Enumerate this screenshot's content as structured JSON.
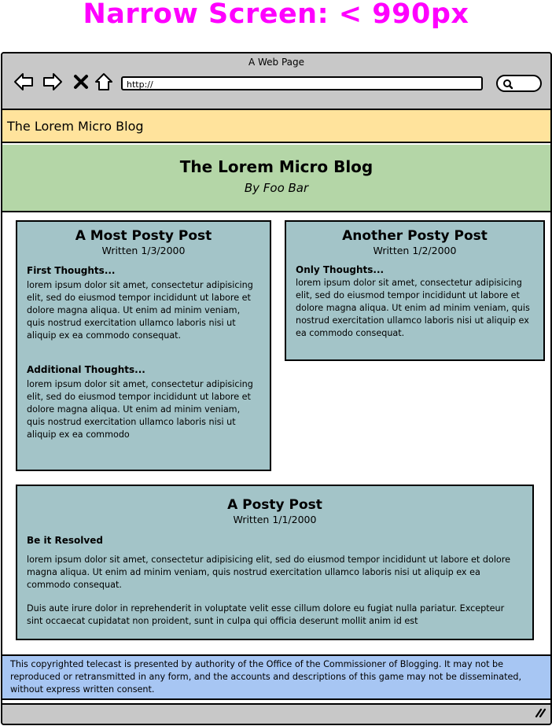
{
  "page_heading": "Narrow Screen: < 990px",
  "browser": {
    "window_title": "A Web Page",
    "url": "http://",
    "nav_icons": [
      "back-arrow-icon",
      "forward-arrow-icon",
      "close-x-icon",
      "home-icon",
      "search-icon",
      "resize-grip-icon"
    ]
  },
  "tab_title": "The Lorem Micro Blog",
  "banner": {
    "title": "The Lorem Micro Blog",
    "author": "By Foo Bar"
  },
  "posts": [
    {
      "title": "A Most Posty Post",
      "date": "Written 1/3/2000",
      "sections": [
        {
          "heading": "First Thoughts...",
          "body": "lorem ipsum dolor sit amet, consectetur adipisicing elit, sed do eiusmod tempor incididunt ut labore et dolore magna aliqua. Ut enim ad minim veniam, quis nostrud exercitation ullamco laboris nisi ut aliquip ex ea commodo consequat."
        },
        {
          "heading": "Additional Thoughts...",
          "body": "lorem ipsum dolor sit amet, consectetur adipisicing elit, sed do eiusmod tempor incididunt ut labore et dolore magna aliqua. Ut enim ad minim veniam, quis nostrud exercitation ullamco laboris nisi ut aliquip ex ea commodo"
        }
      ]
    },
    {
      "title": "Another Posty Post",
      "date": "Written 1/2/2000",
      "sections": [
        {
          "heading": "Only Thoughts...",
          "body": "lorem ipsum dolor sit amet, consectetur adipisicing elit, sed do eiusmod tempor incididunt ut labore et dolore magna aliqua. Ut enim ad minim veniam, quis nostrud exercitation ullamco laboris nisi ut aliquip ex ea commodo consequat."
        }
      ]
    },
    {
      "title": "A Posty Post",
      "date": "Written 1/1/2000",
      "sections": [
        {
          "heading": "Be it Resolved",
          "body": "lorem ipsum dolor sit amet, consectetur adipisicing elit, sed do eiusmod tempor incididunt ut labore et dolore magna aliqua. Ut enim ad minim veniam, quis nostrud exercitation ullamco laboris nisi ut aliquip ex ea commodo consequat."
        },
        {
          "heading": "",
          "body": "Duis aute irure dolor in reprehenderit in voluptate velit esse cillum dolore eu fugiat nulla pariatur. Excepteur sint occaecat cupidatat non proident, sunt in culpa qui officia deserunt mollit anim id est"
        }
      ]
    }
  ],
  "footer_text": "This copyrighted telecast is presented by authority of the Office of the Commissioner of Blogging. It may not be reproduced or retransmitted in any form, and the accounts and descriptions of this game may not be disseminated, without express written consent.",
  "colors": {
    "heading": "#ff00ff",
    "chrome": "#c8c8c8",
    "tab_bar": "#ffe39c",
    "banner": "#b4d6a7",
    "post": "#a3c4c8",
    "footer": "#a7c6f3"
  }
}
